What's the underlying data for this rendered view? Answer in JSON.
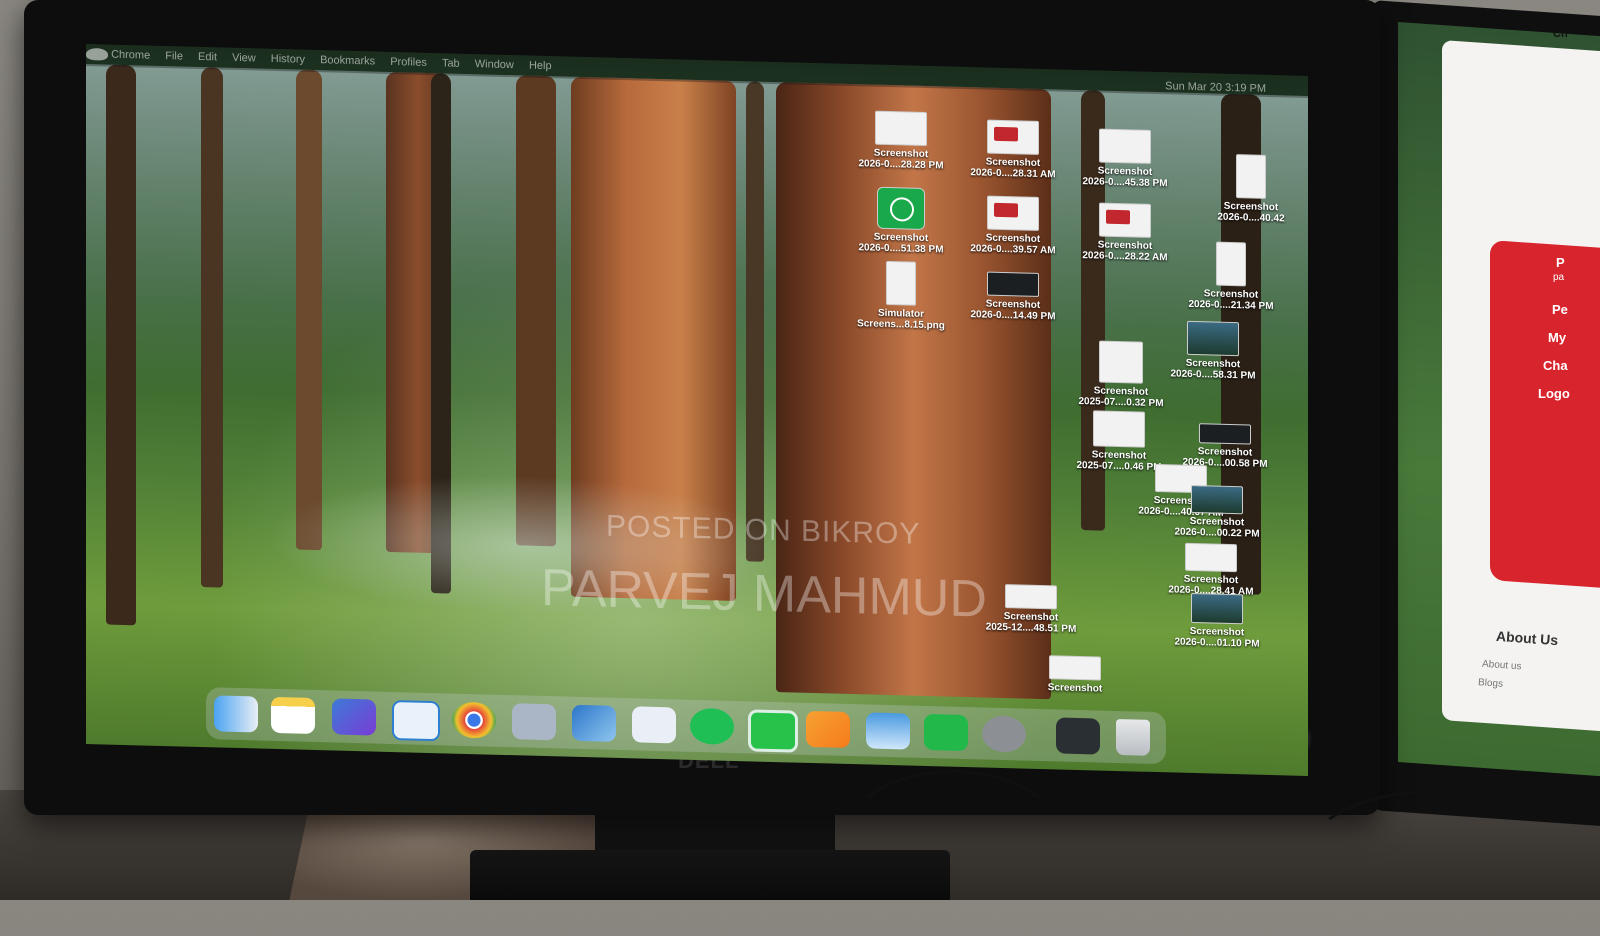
{
  "menubar": {
    "items": [
      "Chrome",
      "File",
      "Edit",
      "View",
      "History",
      "Bookmarks",
      "Profiles",
      "Tab",
      "Window",
      "Help"
    ],
    "clock": "Sun Mar 20  3:19 PM"
  },
  "desktop_files": [
    {
      "name": "Screenshot",
      "date": "2026-0....28.28 PM"
    },
    {
      "name": "Screenshot",
      "date": "2026-0....28.31 AM"
    },
    {
      "name": "Screenshot",
      "date": "2026-0....45.38 PM"
    },
    {
      "name": "Screenshot",
      "date": "2026-0....40.42"
    },
    {
      "name": "Screenshot",
      "date": "2026-0....51.38 PM"
    },
    {
      "name": "Screenshot",
      "date": "2026-0....39.57 AM"
    },
    {
      "name": "Screenshot",
      "date": "2026-0....28.22 AM"
    },
    {
      "name": "Screenshot",
      "date": "2026-0....21.34 PM"
    },
    {
      "name": "Simulator",
      "date": "Screens...8.15.png"
    },
    {
      "name": "Screenshot",
      "date": "2026-0....14.49 PM"
    },
    {
      "name": "Screenshot",
      "date": "2026-0....58.31 PM"
    },
    {
      "name": "Screenshot",
      "date": "2025-07....0.32 PM"
    },
    {
      "name": "Screenshot",
      "date": "2025-07....0.46 PM"
    },
    {
      "name": "Screenshot",
      "date": "2026-0....00.58 PM"
    },
    {
      "name": "Screenshot",
      "date": "2026-0....40.07 AM"
    },
    {
      "name": "Screenshot",
      "date": "2026-0....00.22 PM"
    },
    {
      "name": "Screenshot",
      "date": "2026-0....28.41 AM"
    },
    {
      "name": "Screenshot",
      "date": "2026-0....01.10 PM"
    },
    {
      "name": "Screenshot",
      "date": "2025-12....48.51 PM"
    },
    {
      "name": "Screenshot",
      "date": ""
    }
  ],
  "dock_apps": [
    "finder-icon",
    "notes-icon",
    "xcode-icon",
    "vscode-icon",
    "chrome-icon",
    "preview-icon",
    "simulator-icon",
    "app-store-icon",
    "whatsapp-icon",
    "messages-icon",
    "pages-icon",
    "weather-icon",
    "facetime-icon",
    "settings-icon",
    "recent-window-icon",
    "trash-icon"
  ],
  "watermark": {
    "line1": "POSTED ON BIKROY",
    "line2": "PARVEJ MAHMUD"
  },
  "monitor_brand": "DELL",
  "second_monitor": {
    "menu_items": [
      "P",
      "Pe",
      "My",
      "Cha",
      "Logo"
    ],
    "header_text": "pa",
    "about_title": "About Us",
    "about_links": [
      "About us",
      "Blogs"
    ],
    "top_text": "Ch"
  },
  "colors": {
    "accent_red": "#d8242c",
    "whatsapp_green": "#1aa94a"
  }
}
